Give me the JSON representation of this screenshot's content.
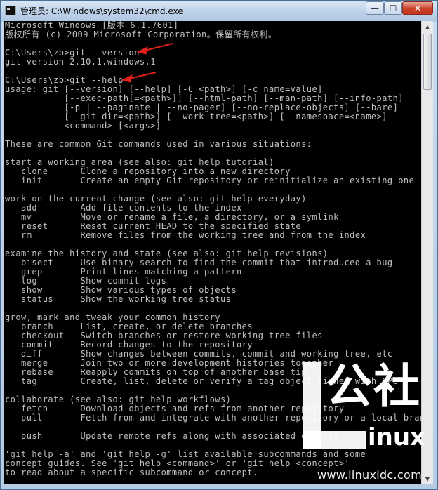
{
  "window": {
    "title": "管理员: C:\\Windows\\system32\\cmd.exe",
    "minimize_glyph": "—",
    "maximize_glyph": "☐",
    "close_glyph": "✕"
  },
  "console": {
    "lines": [
      "Microsoft Windows [版本 6.1.7601]",
      "版权所有 (c) 2009 Microsoft Corporation。保留所有权利。",
      "",
      "C:\\Users\\zb>git --version",
      "git version 2.10.1.windows.1",
      "",
      "C:\\Users\\zb>git --help",
      "usage: git [--version] [--help] [-C <path>] [-c name=value]",
      "           [--exec-path[=<path>]] [--html-path] [--man-path] [--info-path]",
      "           [-p | --paginate | --no-pager] [--no-replace-objects] [--bare]",
      "           [--git-dir=<path>] [--work-tree=<path>] [--namespace=<name>]",
      "           <command> [<args>]",
      "",
      "These are common Git commands used in various situations:",
      "",
      "start a working area (see also: git help tutorial)",
      "   clone      Clone a repository into a new directory",
      "   init       Create an empty Git repository or reinitialize an existing one",
      "",
      "work on the current change (see also: git help everyday)",
      "   add        Add file contents to the index",
      "   mv         Move or rename a file, a directory, or a symlink",
      "   reset      Reset current HEAD to the specified state",
      "   rm         Remove files from the working tree and from the index",
      "",
      "examine the history and state (see also: git help revisions)",
      "   bisect     Use binary search to find the commit that introduced a bug",
      "   grep       Print lines matching a pattern",
      "   log        Show commit logs",
      "   show       Show various types of objects",
      "   status     Show the working tree status",
      "",
      "grow, mark and tweak your common history",
      "   branch     List, create, or delete branches",
      "   checkout   Switch branches or restore working tree files",
      "   commit     Record changes to the repository",
      "   diff       Show changes between commits, commit and working tree, etc",
      "   merge      Join two or more development histories together",
      "   rebase     Reapply commits on top of another base tip",
      "   tag        Create, list, delete or verify a tag object signed with GPG",
      "",
      "collaborate (see also: git help workflows)",
      "   fetch      Download objects and refs from another repository",
      "   pull       Fetch from and integrate with another repository or a local branch",
      "",
      "   push       Update remote refs along with associated objects",
      "",
      "'git help -a' and 'git help -g' list available subcommands and some",
      "concept guides. See 'git help <command>' or 'git help <concept>'",
      "to read about a specific subcommand or concept."
    ]
  },
  "scrollbar": {
    "up_glyph": "▲",
    "down_glyph": "▼"
  },
  "watermark": {
    "logo_text": "公社",
    "logo_suffix": "inux",
    "url": "www.linuxidc.com"
  },
  "annotations": {
    "arrow_color": "#e0201c"
  }
}
